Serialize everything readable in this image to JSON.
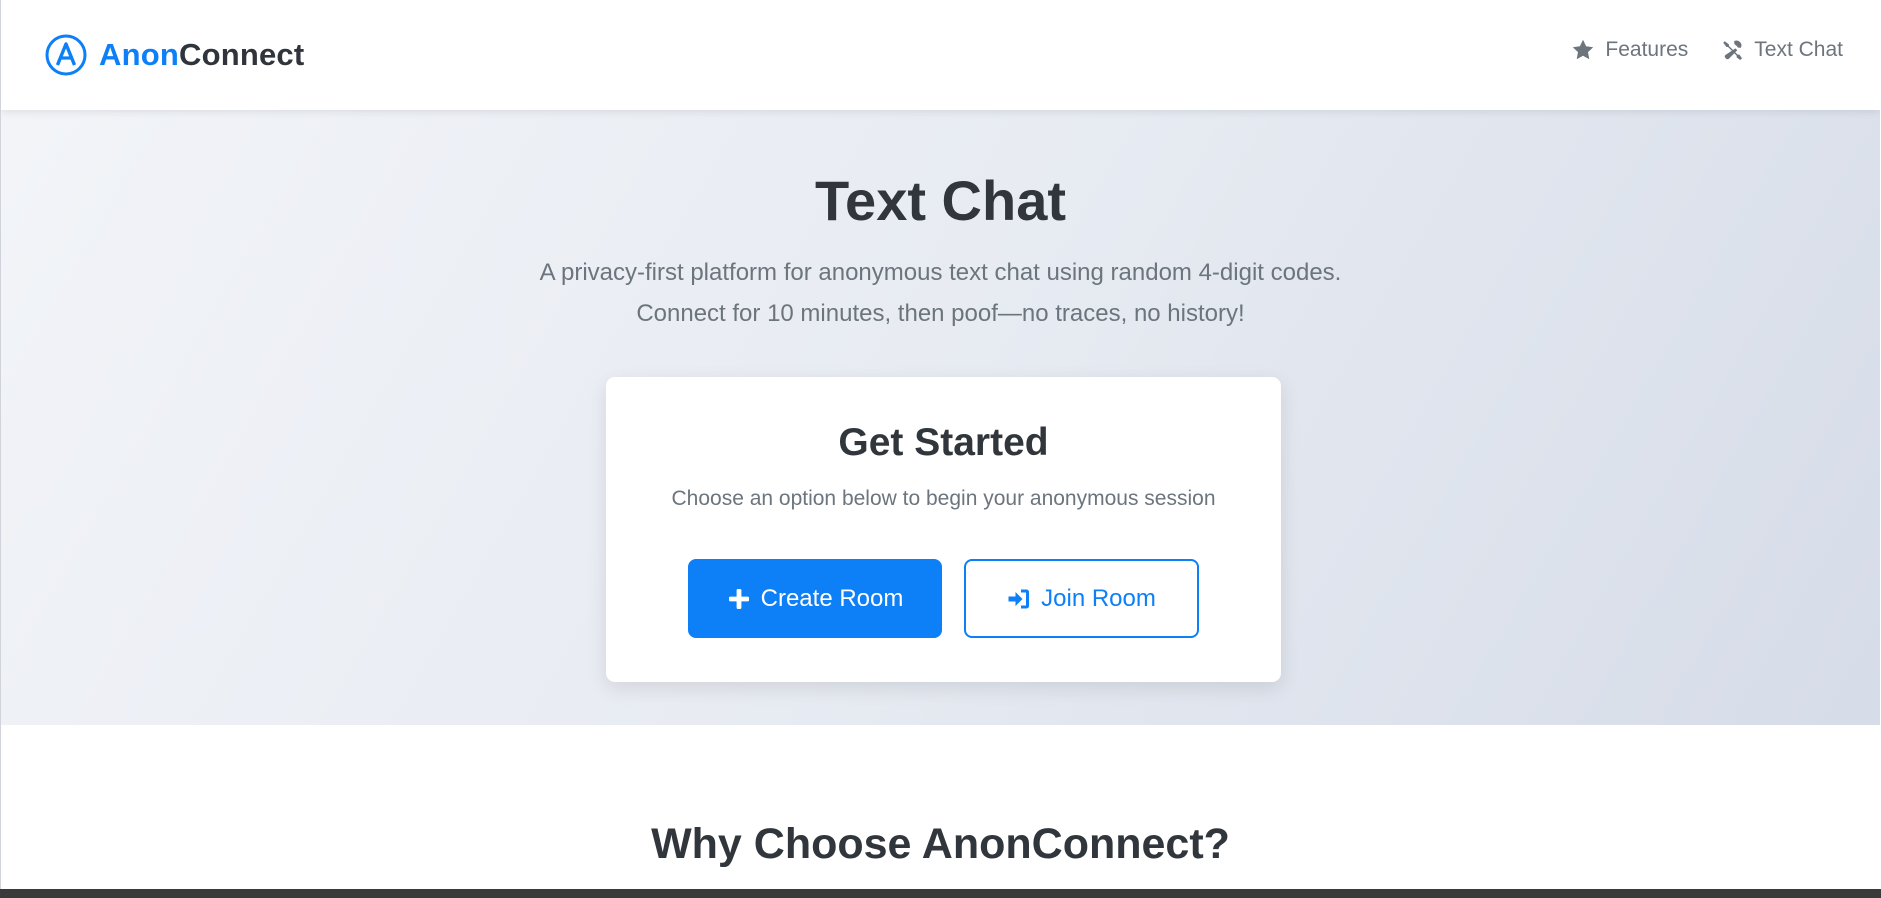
{
  "navbar": {
    "brand": {
      "logo_icon": "circled-a-logo-icon",
      "part1": "Anon",
      "part2": "Connect"
    },
    "links": [
      {
        "icon": "star-icon",
        "label": "Features"
      },
      {
        "icon": "tools-icon",
        "label": "Text Chat"
      }
    ]
  },
  "hero": {
    "title": "Text Chat",
    "subtitle": "A privacy-first platform for anonymous text chat using random 4-digit codes. Connect for 10 minutes, then poof—no traces, no history!"
  },
  "card": {
    "title": "Get Started",
    "subtitle": "Choose an option below to begin your anonymous session",
    "create_label": "Create Room",
    "create_icon": "plus-icon",
    "join_label": "Join Room",
    "join_icon": "sign-in-icon"
  },
  "features": {
    "title": "Why Choose AnonConnect?"
  },
  "colors": {
    "accent": "#0d7ff7",
    "text_dark": "#30363c",
    "text_muted": "#6c757d"
  }
}
